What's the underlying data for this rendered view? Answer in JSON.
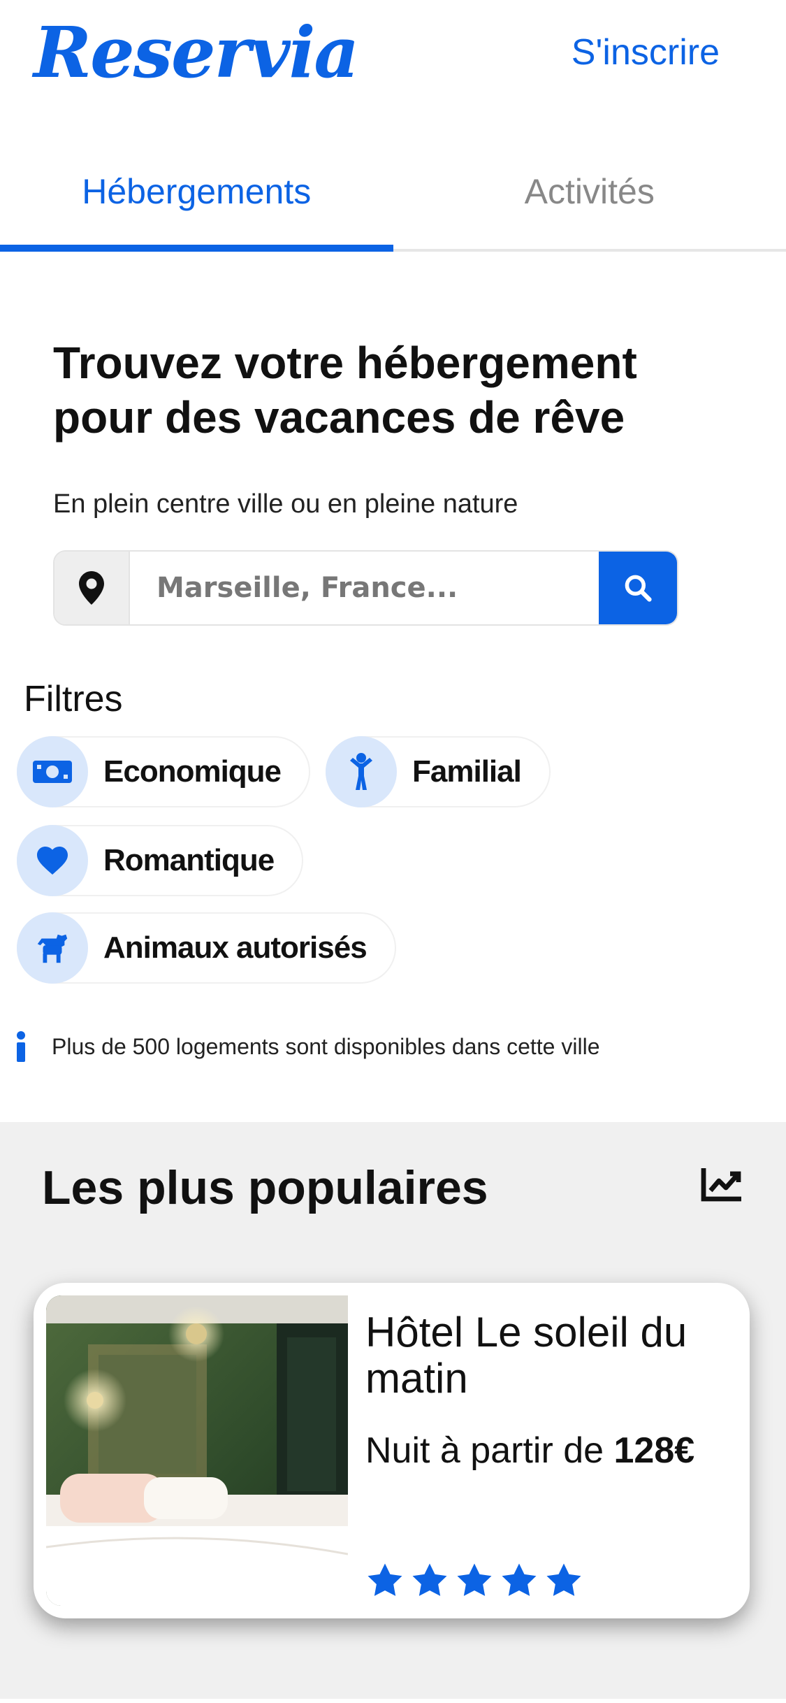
{
  "header": {
    "logo": "Reservia",
    "signup_label": "S'inscrire"
  },
  "tabs": [
    {
      "label": "Hébergements",
      "active": true
    },
    {
      "label": "Activités",
      "active": false
    }
  ],
  "hero": {
    "title": "Trouvez votre hébergement pour des vacances de rêve",
    "subtitle": "En plein centre ville ou en pleine nature",
    "search_placeholder": "Marseille, France..."
  },
  "filters": {
    "title": "Filtres",
    "items": [
      {
        "label": "Economique",
        "icon": "money-icon"
      },
      {
        "label": "Familial",
        "icon": "child-icon"
      },
      {
        "label": "Romantique",
        "icon": "heart-icon"
      },
      {
        "label": "Animaux autorisés",
        "icon": "dog-icon"
      }
    ]
  },
  "info_text": "Plus de 500 logements sont disponibles dans cette ville",
  "popular": {
    "title": "Les plus populaires",
    "card": {
      "name": "Hôtel Le soleil du matin",
      "price_prefix": "Nuit à partir de",
      "price": "128€",
      "rating": 5
    }
  },
  "colors": {
    "accent": "#0c63e4",
    "chip_bg": "#d9e7fb",
    "section_bg": "#f0f0f0"
  }
}
